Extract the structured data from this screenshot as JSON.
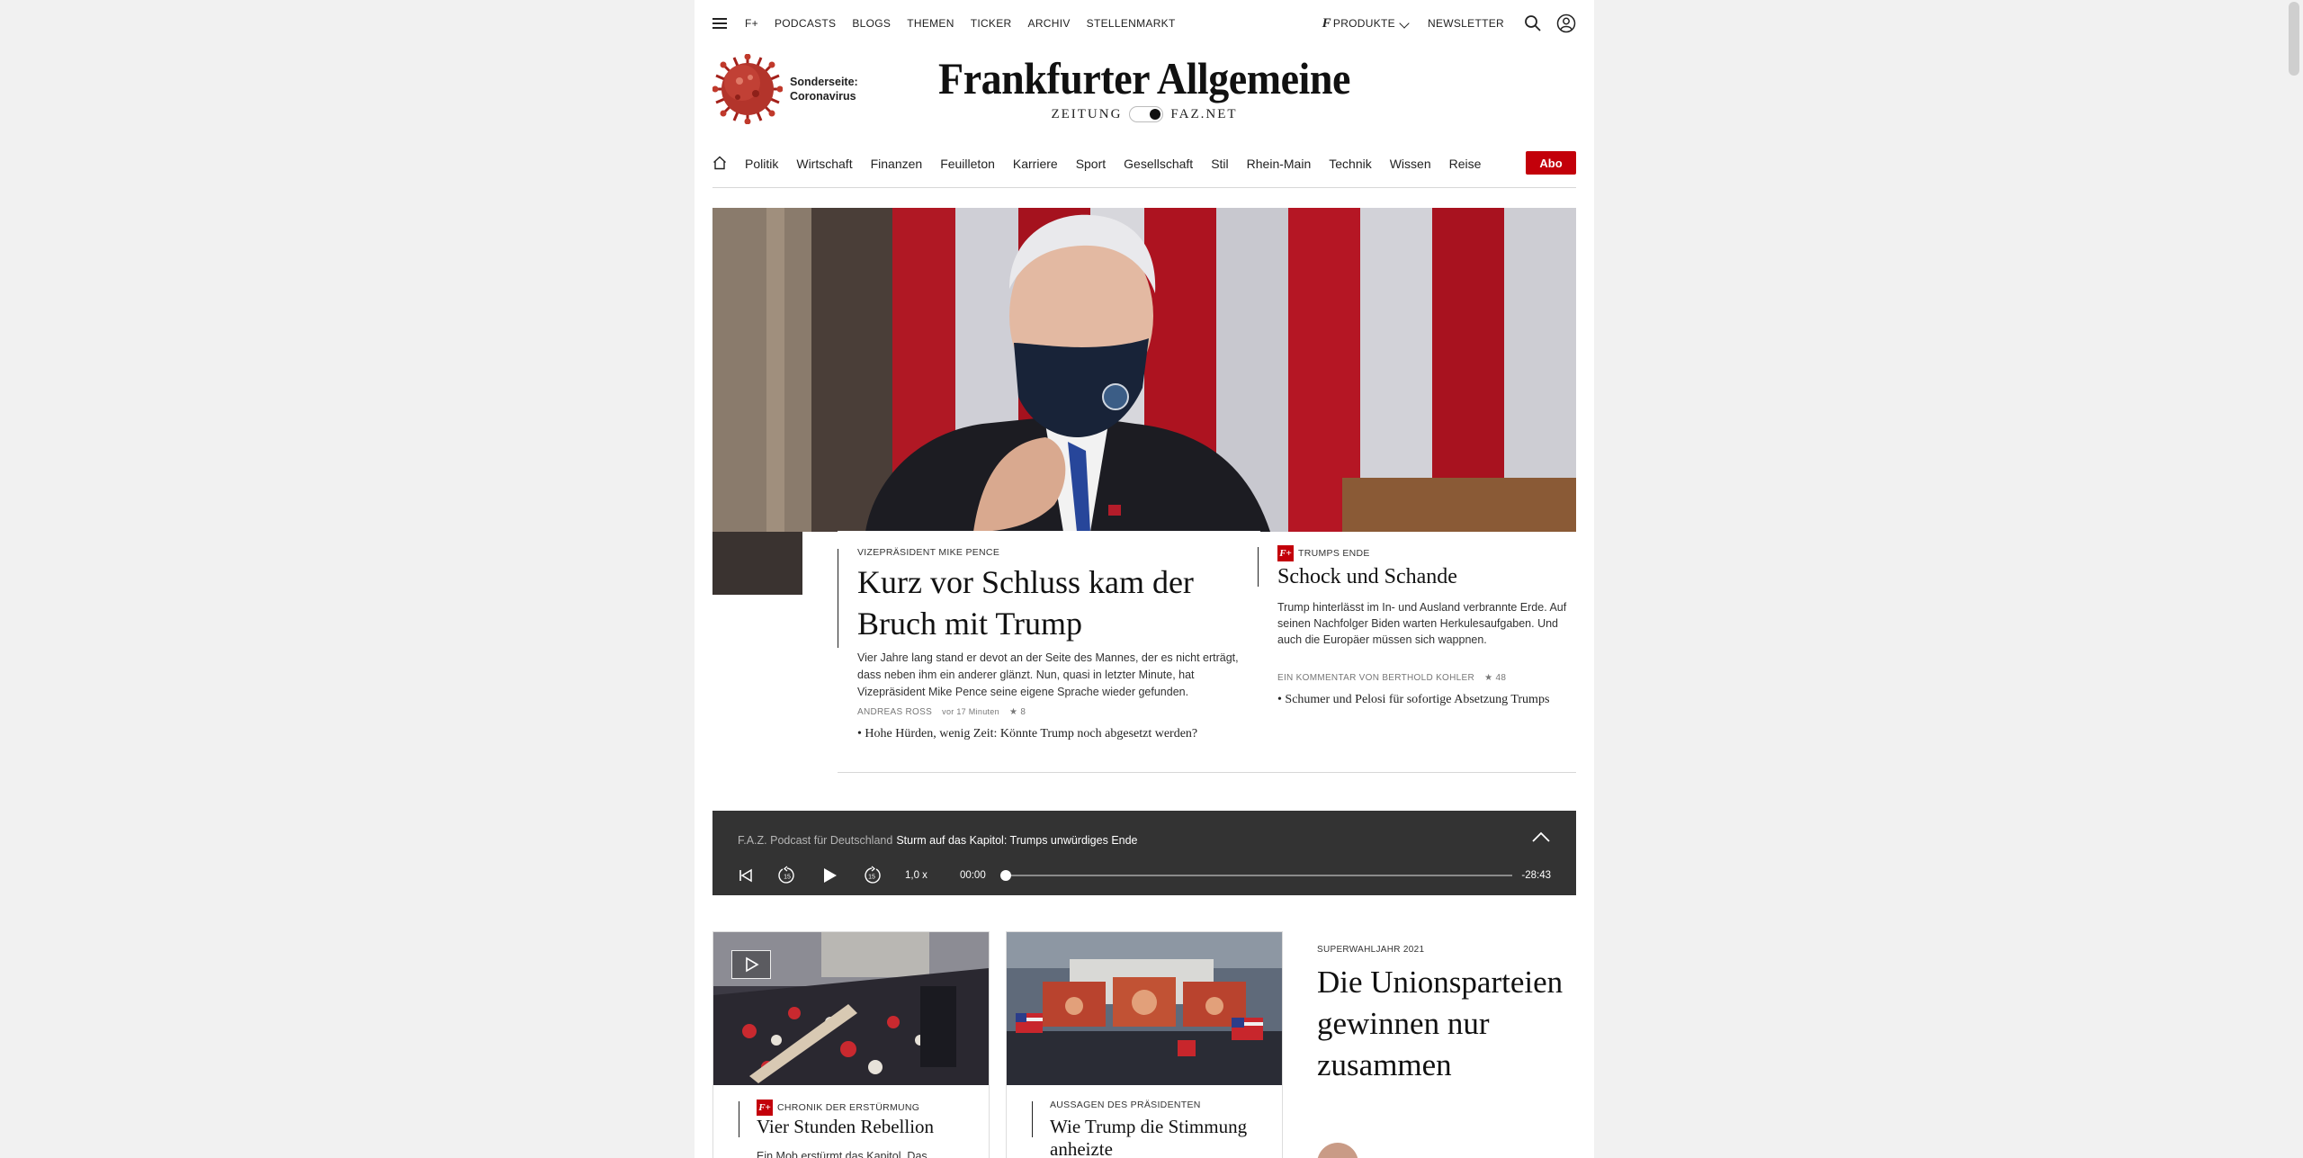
{
  "topnav": {
    "links": [
      "F+",
      "PODCASTS",
      "BLOGS",
      "THEMEN",
      "TICKER",
      "ARCHIV",
      "STELLENMARKT"
    ],
    "produkte_label": "PRODUKTE",
    "newsletter_label": "NEWSLETTER",
    "icons": [
      "menu-icon",
      "search-icon",
      "user-icon"
    ]
  },
  "corona": {
    "line1": "Sonderseite:",
    "line2": "Coronavirus"
  },
  "masthead": {
    "title": "Frankfurter Allgemeine",
    "left": "ZEITUNG",
    "right": "FAZ.NET"
  },
  "ressorts": [
    "Politik",
    "Wirtschaft",
    "Finanzen",
    "Feuilleton",
    "Karriere",
    "Sport",
    "Gesellschaft",
    "Stil",
    "Rhein-Main",
    "Technik",
    "Wissen",
    "Reise"
  ],
  "abo_label": "Abo",
  "hero": {
    "kicker": "VIZEPRÄSIDENT MIKE PENCE",
    "headline": "Kurz vor Schluss kam der Bruch mit Trump",
    "teaser": "Vier Jahre lang stand er devot an der Seite des Mannes, der es nicht erträgt, dass neben ihm ein anderer glänzt. Nun, quasi in letzter Minute, hat Vizepräsident Mike Pence seine eigene Sprache wieder gefunden.",
    "author": "ANDREAS ROSS",
    "time": "vor 17 Minuten",
    "stars": "★ 8",
    "related": "• Hohe Hürden, wenig Zeit: Könnte Trump noch abgesetzt werden?"
  },
  "side": {
    "fplus": "F+",
    "kicker": "TRUMPS ENDE",
    "headline": "Schock und Schande",
    "teaser": "Trump hinterlässt im In- und Ausland verbrannte Erde. Auf seinen Nachfolger Biden warten Herkulesaufgaben. Und auch die Europäer müssen sich wappnen.",
    "byline": "EIN KOMMENTAR VON BERTHOLD KOHLER",
    "stars": "★ 48",
    "related": "• Schumer und Pelosi für sofortige Absetzung Trumps"
  },
  "player": {
    "series": "F.A.Z. Podcast für Deutschland",
    "title": "Sturm auf das Kapitol: Trumps unwürdiges Ende",
    "speed": "1,0 x",
    "current": "00:00",
    "remaining": "-28:43",
    "progress": 0
  },
  "cards": [
    {
      "fplus": "F+",
      "kicker": "CHRONIK DER ERSTÜRMUNG",
      "headline": "Vier Stunden Rebellion",
      "teaser": "Ein Mob erstürmt das Kapitol. Das"
    },
    {
      "kicker": "AUSSAGEN DES PRÄSIDENTEN",
      "headline": "Wie Trump die Stimmung anheizte"
    }
  ],
  "topstory": {
    "kicker": "SUPERWAHLJAHR 2021",
    "headline": "Die Unionsparteien gewinnen nur zusammen"
  },
  "colors": {
    "brand_red": "#c3000a",
    "player_bg": "#333333"
  }
}
